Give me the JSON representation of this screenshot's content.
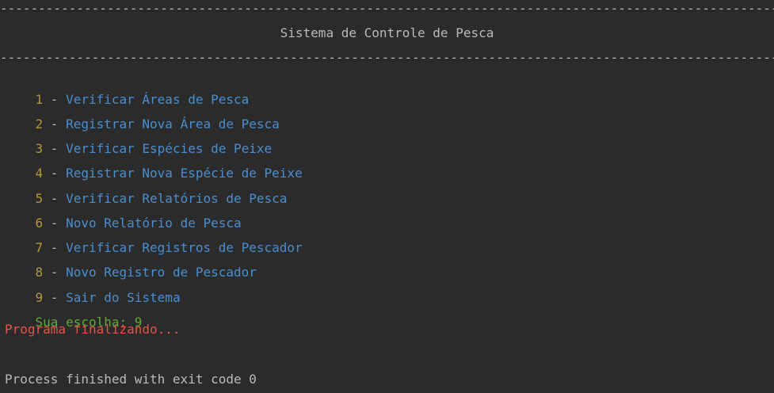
{
  "divider": "--------------------------------------------------------------------------------------------------------------",
  "title": "Sistema de Controle de Pesca",
  "menu": [
    {
      "num": "1",
      "sep": " - ",
      "label": "Verificar Áreas de Pesca"
    },
    {
      "num": "2",
      "sep": " - ",
      "label": "Registrar Nova Área de Pesca"
    },
    {
      "num": "3",
      "sep": " - ",
      "label": "Verificar Espécies de Peixe"
    },
    {
      "num": "4",
      "sep": " - ",
      "label": "Registrar Nova Espécie de Peixe"
    },
    {
      "num": "5",
      "sep": " - ",
      "label": "Verificar Relatórios de Pesca"
    },
    {
      "num": "6",
      "sep": " - ",
      "label": "Novo Relatório de Pesca"
    },
    {
      "num": "7",
      "sep": " - ",
      "label": "Verificar Registros de Pescador"
    },
    {
      "num": "8",
      "sep": " - ",
      "label": "Novo Registro de Pescador"
    },
    {
      "num": "9",
      "sep": " - ",
      "label": "Sair do Sistema"
    }
  ],
  "prompt": {
    "label": "Sua escolha: ",
    "value": "9"
  },
  "status": "Programa finalizando...",
  "exit_message": "Process finished with exit code 0",
  "colors": {
    "background": "#2b2b2b",
    "number": "#b29b37",
    "label": "#4a8fd0",
    "prompt": "#5fa836",
    "error": "#e5534b",
    "default": "#bbbbbb"
  }
}
